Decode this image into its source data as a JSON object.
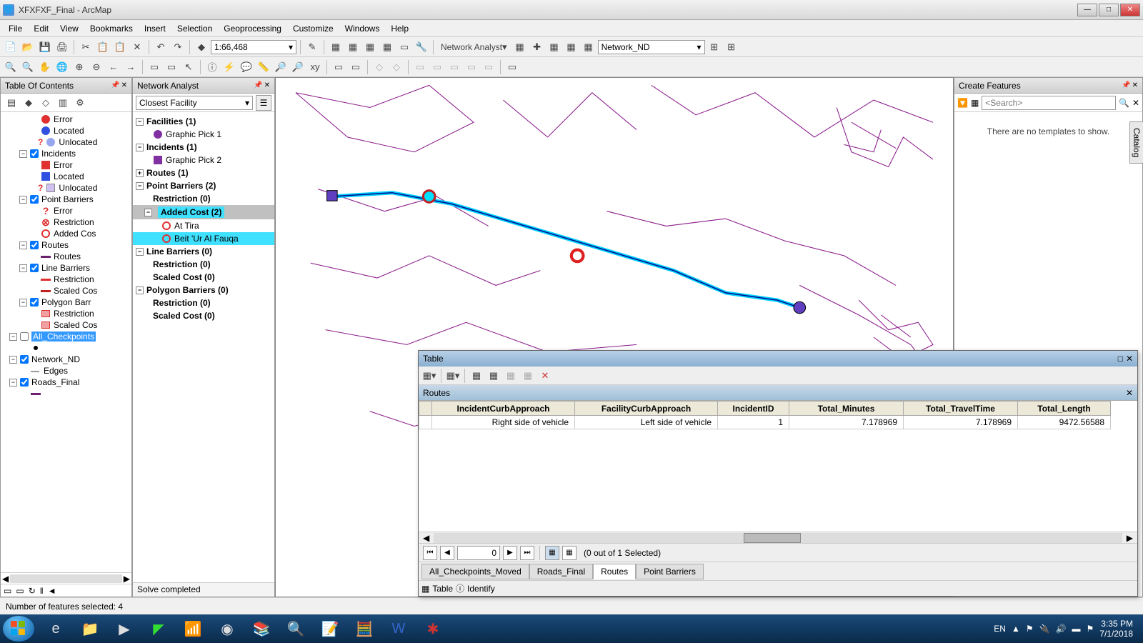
{
  "window": {
    "title": "XFXFXF_Final - ArcMap"
  },
  "menus": [
    "File",
    "Edit",
    "View",
    "Bookmarks",
    "Insert",
    "Selection",
    "Geoprocessing",
    "Customize",
    "Windows",
    "Help"
  ],
  "scale": "1:66,468",
  "na_dropdown_label": "Network Analyst",
  "network_dataset": "Network_ND",
  "toc": {
    "title": "Table Of Contents",
    "items": {
      "error": "Error",
      "located": "Located",
      "unlocated": "Unlocated",
      "incidents": "Incidents",
      "point_barriers": "Point Barriers",
      "restriction": "Restriction",
      "added_cos": "Added Cos",
      "routes": "Routes",
      "routes_sub": "Routes",
      "line_barriers": "Line Barriers",
      "scaled_cos": "Scaled Cos",
      "polygon_barr": "Polygon Barr",
      "all_checkpoints": "All_Checkpoints",
      "network_nd": "Network_ND",
      "edges": "Edges",
      "roads_final": "Roads_Final"
    }
  },
  "na_panel": {
    "title": "Network Analyst",
    "analysis": "Closest Facility",
    "status": "Solve completed",
    "nodes": {
      "facilities": "Facilities (1)",
      "facilities_c1": "Graphic Pick 1",
      "incidents": "Incidents (1)",
      "incidents_c1": "Graphic Pick 2",
      "routes": "Routes (1)",
      "point_barriers": "Point Barriers (2)",
      "pb_restriction": "Restriction (0)",
      "pb_added": "Added Cost (2)",
      "pb_added_c1": "At Tira",
      "pb_added_c2": "Beit 'Ur Al Fauqa",
      "line_barriers": "Line Barriers (0)",
      "lb_restriction": "Restriction (0)",
      "lb_scaled": "Scaled Cost (0)",
      "polygon_barriers": "Polygon Barriers (0)",
      "pgb_restriction": "Restriction (0)",
      "pgb_scaled": "Scaled Cost (0)"
    }
  },
  "cf_panel": {
    "title": "Create Features",
    "search_placeholder": "<Search>",
    "empty": "There are no templates to show."
  },
  "side_tab": "Catalog",
  "table": {
    "title": "Table",
    "subtitle": "Routes",
    "columns": [
      "IncidentCurbApproach",
      "FacilityCurbApproach",
      "IncidentID",
      "Total_Minutes",
      "Total_TravelTime",
      "Total_Length"
    ],
    "row": {
      "ica": "Right side of vehicle",
      "fca": "Left side of vehicle",
      "iid": "1",
      "tmin": "7.178969",
      "ttt": "7.178969",
      "tlen": "9472.56588"
    },
    "nav_pos": "0",
    "nav_status": "(0 out of 1 Selected)",
    "tabs": [
      "All_Checkpoints_Moved",
      "Roads_Final",
      "Routes",
      "Point Barriers"
    ],
    "active_tab": 2,
    "bottom_table": "Table",
    "bottom_identify": "Identify"
  },
  "statusbar": {
    "text": "Number of features selected: 4"
  },
  "taskbar": {
    "lang": "EN",
    "time": "3:35 PM",
    "date": "7/1/2018"
  }
}
